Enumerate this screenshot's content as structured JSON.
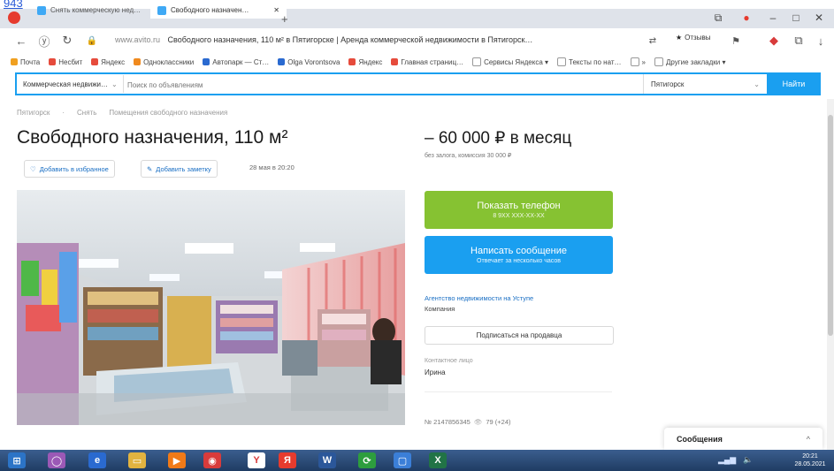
{
  "corner_number": "943",
  "browser": {
    "tabs": [
      {
        "label": "Снять коммерческую нед…",
        "favicon_color": "#3fa9f5"
      },
      {
        "label": "Свободного назначен…",
        "favicon_color": "#3fa9f5"
      }
    ],
    "new_tab_symbol": "+",
    "address_domain": "www.avito.ru",
    "address_title": "Свободного назначения, 110 м² в Пятигорске | Аренда коммерческой недвижимости в Пятигорск…",
    "reviews_label": "Отзывы",
    "window_controls": {
      "minimize": "–",
      "maximize": "□",
      "close": "✕"
    }
  },
  "bookmarks": [
    {
      "label": "Почта",
      "color": "#f0a020"
    },
    {
      "label": "Несбит",
      "color": "#e64b3c"
    },
    {
      "label": "Яндекс",
      "color": "#e64b3c"
    },
    {
      "label": "Одноклассники",
      "color": "#f08a1e"
    },
    {
      "label": "Автопарк — Ст…",
      "color": "#2a6ad0"
    },
    {
      "label": "Olga Vorontsova",
      "color": "#2a6ad0"
    },
    {
      "label": "Яндекс",
      "color": "#e64b3c"
    },
    {
      "label": "Главная страниц…",
      "color": "#e64b3c"
    },
    {
      "label": "Сервисы Яндекса ▾",
      "color": "#ffffff"
    },
    {
      "label": "Тексты по нат…",
      "color": "#ffffff"
    },
    {
      "label": "»",
      "color": "#ffffff"
    },
    {
      "label": "Другие закладки ▾",
      "color": "#ffffff"
    }
  ],
  "search": {
    "category": "Коммерческая недвижи…",
    "placeholder": "Поиск по объявлениям",
    "city": "Пятигорск",
    "button_label": "Найти"
  },
  "breadcrumb": [
    "Пятигорск",
    "Снять",
    "Помещения свободного назначения"
  ],
  "listing": {
    "title": "Свободного назначения, 110 м²",
    "price": "– 60 000 ₽ в месяц",
    "price_note": "без залога, комиссия 30 000 ₽",
    "favorite_label": "Добавить в избранное",
    "note_label": "Добавить заметку",
    "date": "28 мая в 20:20",
    "item_number": "№ 2147856345",
    "views": "79 (+24)"
  },
  "contact": {
    "phone_button": "Показать телефон",
    "phone_masked": "8 9ХХ ХХХ-ХХ-ХХ",
    "message_button": "Написать сообщение",
    "message_sub": "Отвечает за несколько часов",
    "seller_link": "Агентство недвижимости на Уступе",
    "seller_type": "Компания",
    "subscribe_label": "Подписаться на продавца",
    "contact_person_label": "Контактное лицо",
    "contact_person": "Ирина"
  },
  "messages_widget": {
    "label": "Сообщения",
    "chevron": "^"
  },
  "taskbar": {
    "apps": [
      {
        "icon": "windows-start-icon",
        "color": "#2c74c7",
        "glyph": "⊞"
      },
      {
        "icon": "chat-app-icon",
        "color": "#9b59b6",
        "glyph": "◯"
      },
      {
        "icon": "browser-icon",
        "color": "#2a6ad0",
        "glyph": "e"
      },
      {
        "icon": "folder-icon",
        "color": "#e2b340",
        "glyph": "▭"
      },
      {
        "icon": "media-player-icon",
        "color": "#f07a18",
        "glyph": "▶"
      },
      {
        "icon": "app-icon",
        "color": "#d83b3b",
        "glyph": "◉"
      },
      {
        "icon": "yandex-icon",
        "color": "#ffffff",
        "glyph": "Y"
      },
      {
        "icon": "yandex-browser-icon",
        "color": "#e63b2e",
        "glyph": "Я"
      },
      {
        "icon": "word-icon",
        "color": "#2b579a",
        "glyph": "W"
      },
      {
        "icon": "sync-icon",
        "color": "#2d9d3e",
        "glyph": "⟳"
      },
      {
        "icon": "window-icon",
        "color": "#3b7fd8",
        "glyph": "▢"
      },
      {
        "icon": "excel-icon",
        "color": "#217346",
        "glyph": "X"
      }
    ],
    "clock_time": "20:21",
    "clock_date": "28.05.2021"
  }
}
